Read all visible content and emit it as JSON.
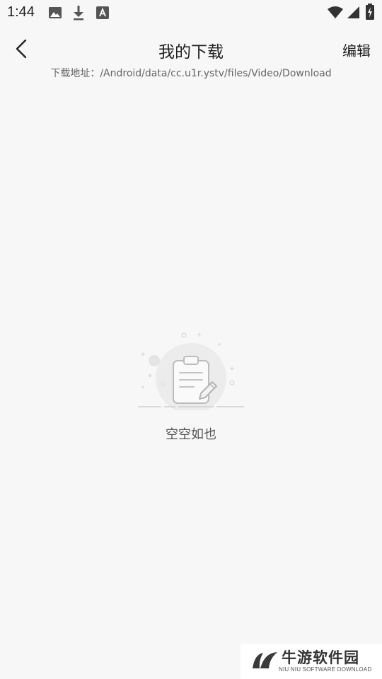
{
  "status_bar": {
    "time": "1:44",
    "icons": [
      "image-icon",
      "download-icon",
      "font-a-icon",
      "wifi-icon",
      "signal-icon",
      "battery-icon"
    ]
  },
  "header": {
    "title": "我的下载",
    "edit_label": "编辑",
    "back_icon": "chevron-left-icon"
  },
  "download_path": "下载地址：/Android/data/cc.u1r.ystv/files/Video/Download",
  "empty_state": {
    "text": "空空如也",
    "icon": "clipboard-edit-icon"
  },
  "watermark": {
    "name": "牛游软件园",
    "subtitle": "NIU NIU SOFTWARE DOWNLOAD"
  }
}
